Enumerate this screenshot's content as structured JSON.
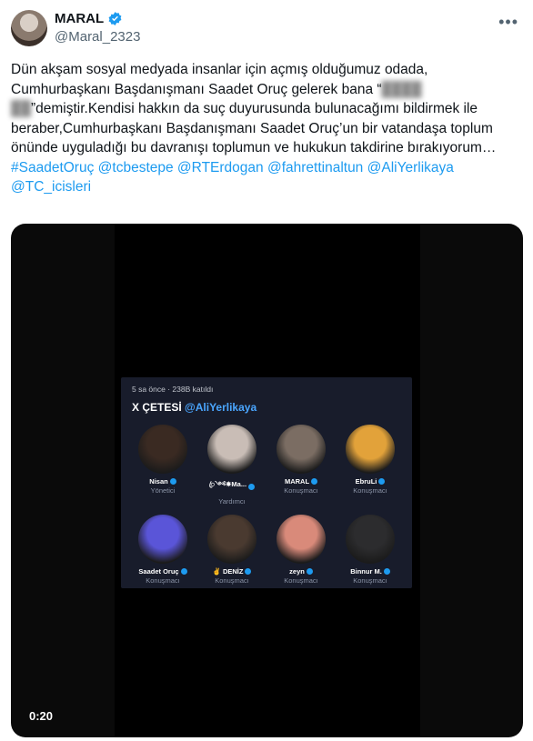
{
  "author": {
    "display_name": "MARAL",
    "handle": "@Maral_2323"
  },
  "menu_icon": "more-horizontal-icon",
  "tweet": {
    "p1": "Dün akşam sosyal medyada insanlar için açmış olduğumuz odada, Cumhurbaşkanı Başdanışmanı Saadet  Oruç gelerek bana “",
    "blurred": "████ ██",
    "p2": "”demiştir.Kendisi hakkın da suç duyurusunda bulunacağımı bildirmek ile beraber,Cumhurbaşkanı Başdanışmanı Saadet Oruç’un bir vatandaşa toplum önünde uyguladığı bu davranışı toplumun ve hukukun takdirine bırakıyorum…",
    "links": [
      "#SaadetOruç",
      "@tcbestepe",
      "@RTErdogan",
      "@fahrettinaltun",
      "@AliYerlikaya",
      "@TC_icisleri"
    ]
  },
  "video": {
    "timecode": "0:20",
    "room": {
      "meta": "5 sa önce · 238B katıldı",
      "title": "X ÇETESİ",
      "title_mention": "@AliYerlikaya",
      "participants": [
        {
          "name": "Nisan",
          "role": "Yönetici",
          "color": "#3a2a22"
        },
        {
          "name": "ꦿ༺✵Ma...",
          "role": "Yardımcı",
          "color": "#c9bdb6"
        },
        {
          "name": "MARAL",
          "role": "Konuşmacı",
          "color": "#7b6d63"
        },
        {
          "name": "EbruLi",
          "role": "Konuşmacı",
          "color": "#e2a23a"
        },
        {
          "name": "Saadet Oruç",
          "role": "Konuşmacı",
          "color": "#5a55d8"
        },
        {
          "name": "✌ DENİZ",
          "role": "Konuşmacı",
          "color": "#4a3a30"
        },
        {
          "name": "zeyn",
          "role": "Konuşmacı",
          "color": "#d98a7a"
        },
        {
          "name": "Binnur M.",
          "role": "Konuşmacı",
          "color": "#2c2c2e"
        }
      ]
    }
  }
}
